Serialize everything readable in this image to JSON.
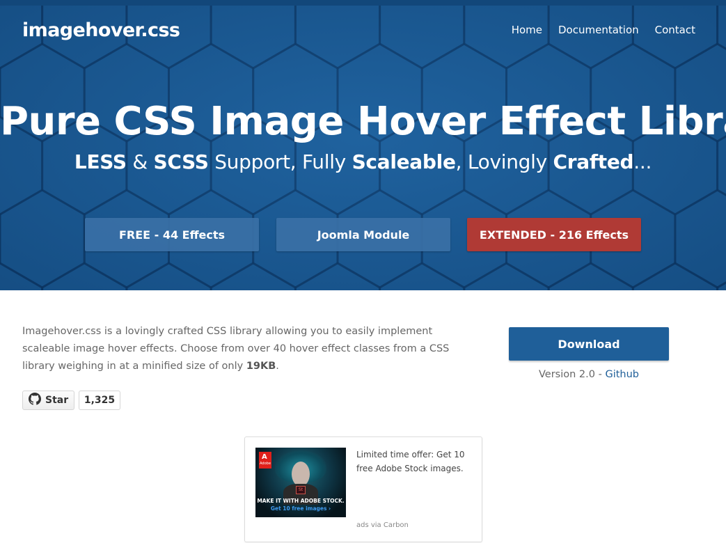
{
  "header": {
    "logo": "imagehover.css",
    "nav": [
      "Home",
      "Documentation",
      "Contact"
    ]
  },
  "hero": {
    "headline": "Pure CSS Image Hover Effect Library",
    "subline": {
      "less": "LESS",
      "amp": " & ",
      "scss": "SCSS",
      "support": " Support, Fully ",
      "scaleable": "Scaleable",
      "lovingly": ", Lovingly ",
      "crafted": "Crafted",
      "ellipsis": "..."
    },
    "buttons": {
      "free": "FREE - 44 Effects",
      "joomla": "Joomla Module",
      "extended": "EXTENDED - 216 Effects"
    }
  },
  "intro": {
    "text": "Imagehover.css is a lovingly crafted CSS library allowing you to easily implement scaleable image hover effects. Choose from over 40 hover effect classes from a CSS library weighing in at a minified size of only ",
    "size": "19KB",
    "end": "."
  },
  "github": {
    "star_label": "Star",
    "count": "1,325"
  },
  "download": {
    "label": "Download",
    "version": "Version 2.0 - ",
    "github_link": "Github"
  },
  "ad": {
    "image_line1": "MAKE IT WITH ADOBE STOCK.",
    "image_line2": "Get 10 free images ›",
    "adobe_logo": "Adobe",
    "stock_badge": "St",
    "text": "Limited time offer: Get 10 free Adobe Stock images.",
    "via": "ads via Carbon"
  },
  "colors": {
    "hero_blue": "#1b5c96",
    "button_blue": "#3a70a6",
    "button_red": "#b03a35",
    "download_blue": "#1f5f99"
  }
}
